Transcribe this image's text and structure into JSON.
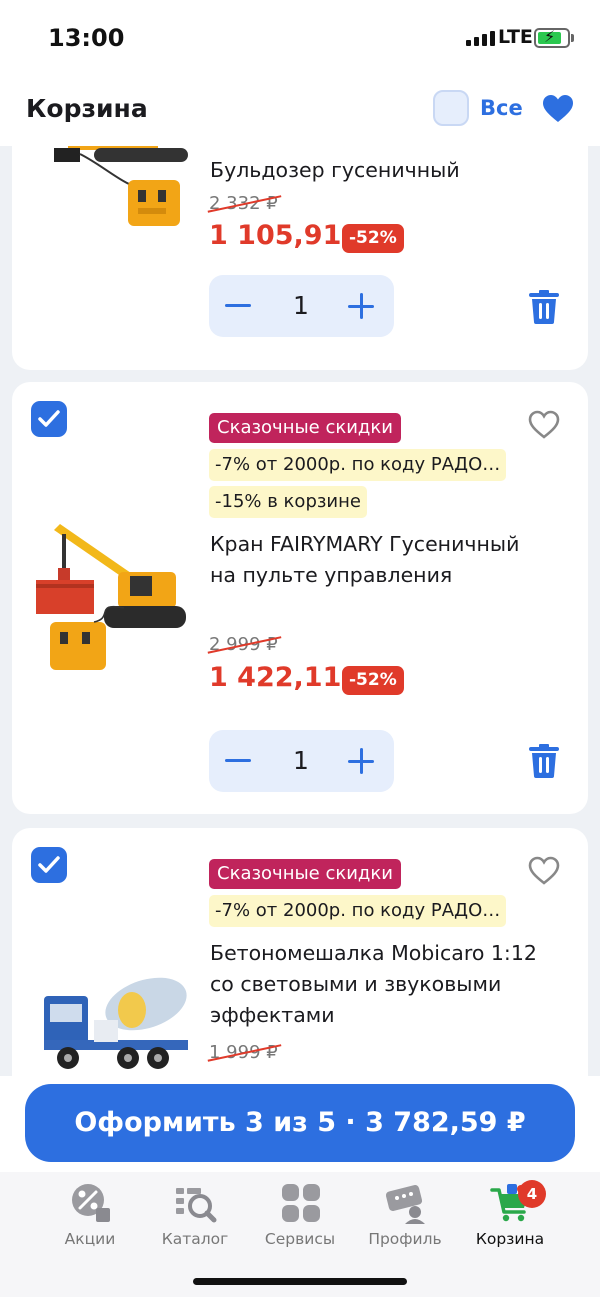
{
  "status_bar": {
    "time": "13:00",
    "network": "LTE"
  },
  "header": {
    "title": "Корзина",
    "select_all_label": "Все"
  },
  "items": [
    {
      "name_line": "Бульдозер гусеничный",
      "old_price": "2 332 ₽",
      "price": "1 105,91 ₽",
      "discount": "-52%",
      "quantity": "1"
    },
    {
      "promo_badge": "Сказочные скидки",
      "promo_code_badge": "-7% от 2000р. по коду РАДО…",
      "cart_discount_badge": "-15% в корзине",
      "name": "Кран FAIRYMARY Гусеничный на пульте управления",
      "old_price": "2 999 ₽",
      "price": "1 422,11 ₽",
      "discount": "-52%",
      "quantity": "1"
    },
    {
      "promo_badge": "Сказочные скидки",
      "promo_code_badge": "-7% от 2000р. по коду РАДО…",
      "name": "Бетономешалка Mobicaro 1:12 со световыми и звуковыми эффектами",
      "old_price": "1 999 ₽"
    }
  ],
  "checkout": {
    "label": "Оформить 3 из 5 · 3 782,59 ₽"
  },
  "tabs": [
    {
      "label": "Акции",
      "icon": "percent-icon"
    },
    {
      "label": "Каталог",
      "icon": "catalog-search-icon"
    },
    {
      "label": "Сервисы",
      "icon": "services-grid-icon"
    },
    {
      "label": "Профиль",
      "icon": "profile-icon"
    },
    {
      "label": "Корзина",
      "icon": "cart-icon",
      "badge": "4"
    }
  ],
  "colors": {
    "accent": "#2d6fe0",
    "price_red": "#e03a2a",
    "promo_pink": "#c0245c"
  }
}
